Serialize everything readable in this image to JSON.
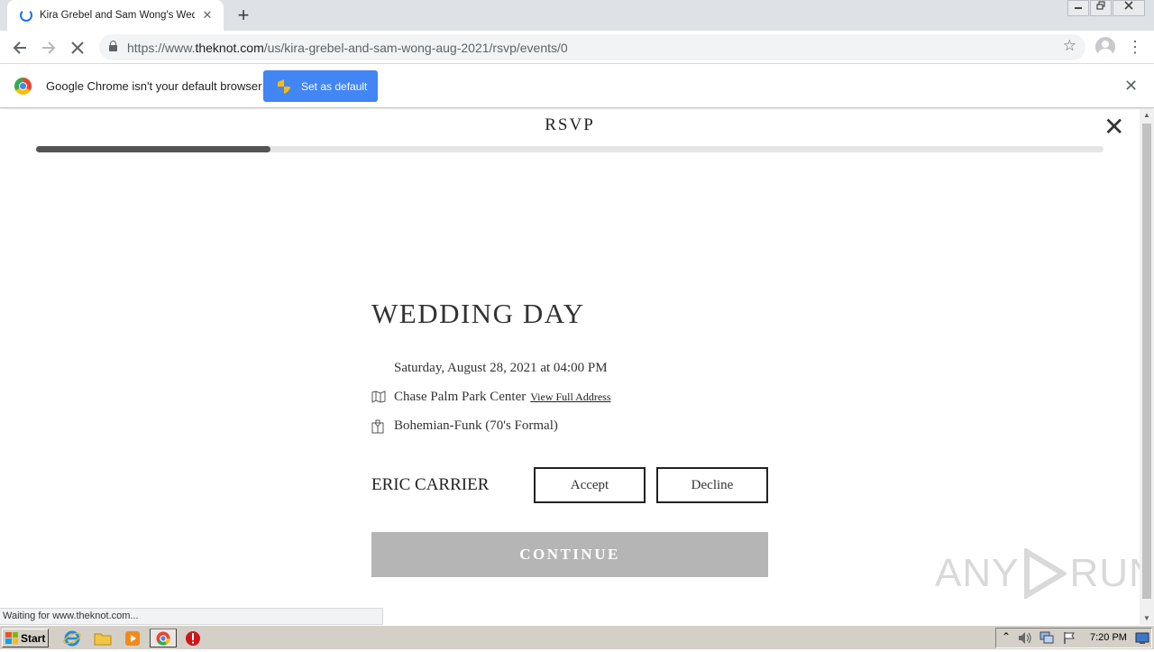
{
  "browser": {
    "tab_title": "Kira Grebel and Sam Wong's Wedding",
    "new_tab_label": "+",
    "url_scheme": "https://www.",
    "url_host": "theknot.com",
    "url_path": "/us/kira-grebel-and-sam-wong-aug-2021/rsvp/events/0"
  },
  "infobar": {
    "message": "Google Chrome isn't your default browser",
    "button_label": "Set as default"
  },
  "rsvp": {
    "header": "RSVP",
    "progress_fraction": 0.22,
    "event_title": "WEDDING DAY",
    "date_time": "Saturday, August 28, 2021 at 04:00 PM",
    "venue": "Chase Palm Park Center",
    "view_address_link": "View Full Address",
    "attire": "Bohemian-Funk (70's Formal)",
    "guest_name": "ERIC CARRIER",
    "accept_label": "Accept",
    "decline_label": "Decline",
    "continue_label": "CONTINUE"
  },
  "status_bar": "Waiting for www.theknot.com...",
  "watermark": {
    "left": "ANY",
    "right": "RUN"
  },
  "taskbar": {
    "start_label": "Start",
    "clock": "7:20 PM"
  },
  "colors": {
    "accent_blue": "#4285f4",
    "progress_fill": "#555555",
    "continue_disabled": "#b5b5b5"
  }
}
